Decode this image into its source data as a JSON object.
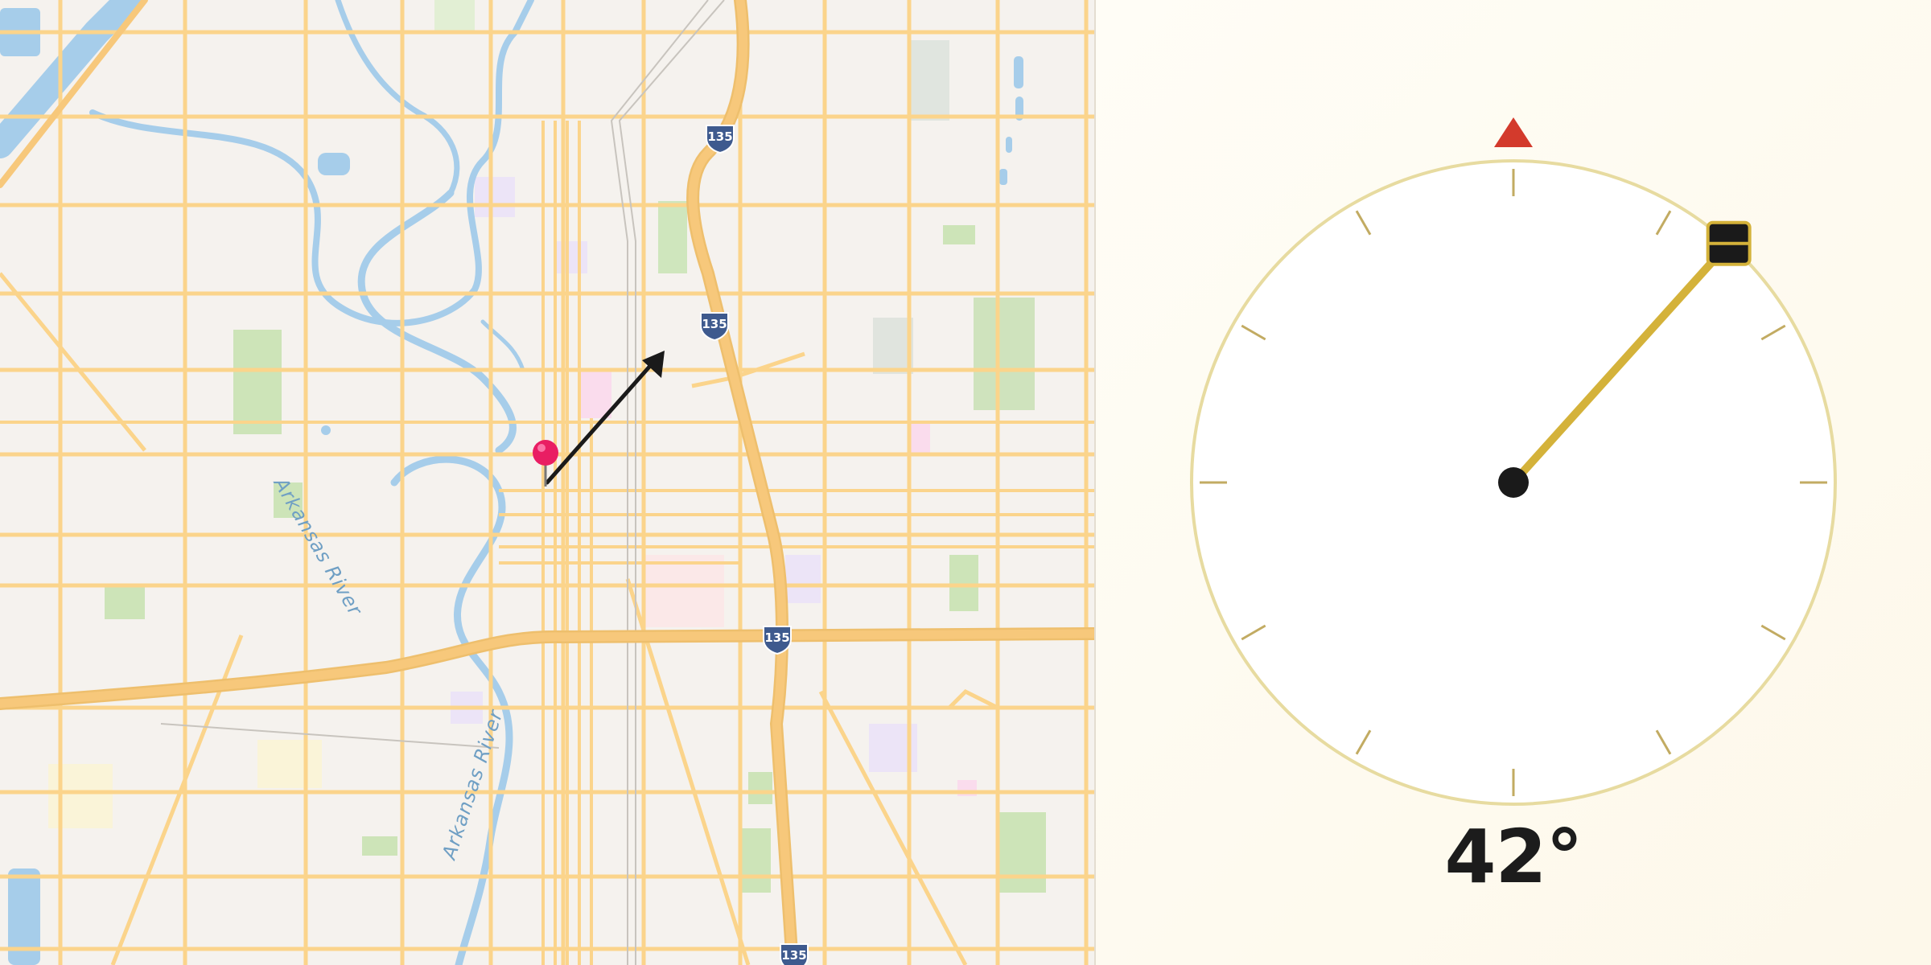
{
  "map": {
    "river_label_1": "Arkansas River",
    "river_label_2": "Arkansas River",
    "highway_shield_label": "135",
    "colors": {
      "background": "#f5f2ee",
      "road": "#fbd48b",
      "road_casing": "#eebf6d",
      "highway": "#f6c16e",
      "water": "#a6cdea",
      "park": "#c9e3b5",
      "pin": "#e91e63",
      "direction_arrow": "#1a1a1a"
    },
    "icons": {
      "pin": "map-pin-icon",
      "arrow": "direction-arrow-icon",
      "shield": "interstate-shield-icon"
    }
  },
  "compass": {
    "heading_deg": 42,
    "heading_label": "42°",
    "icons": {
      "north": "north-marker-icon",
      "needle": "heading-needle-icon",
      "handle": "needle-handle-icon",
      "pivot": "pivot-icon"
    },
    "colors": {
      "ring": "#e7dba0",
      "ticks": "#c2ab62",
      "north_marker": "#d33a2c",
      "needle": "#d4b23a",
      "handle": "#1a1a1a",
      "pivot": "#1a1a1a",
      "dial_fill": "#ffffff"
    }
  }
}
